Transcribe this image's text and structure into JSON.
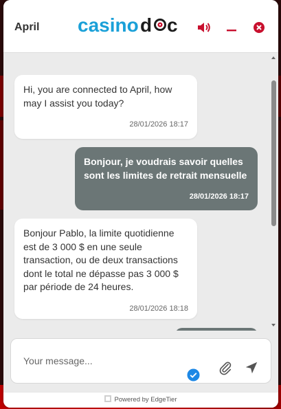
{
  "header": {
    "agent_name": "April",
    "logo_text_a": "casino",
    "logo_text_b": "d",
    "logo_text_c": "c",
    "icons": [
      "sound-icon",
      "minimize-icon",
      "close-icon"
    ]
  },
  "messages": [
    {
      "sender": "agent",
      "text": "Hi, you are connected to April, how\nmay I assist you today?",
      "time": "28/01/2026 18:17"
    },
    {
      "sender": "user",
      "text": "Bonjour, je voudrais savoir quelles\nsont les limites de retrait mensuelle",
      "time": "28/01/2026 18:17"
    },
    {
      "sender": "agent",
      "text": "Bonjour Pablo, la limite quotidienne\nest de 3 000 $ en une seule\ntransaction, ou de deux transactions\ndont le total ne dépasse pas 3 000 $\npar période de 24 heures.",
      "time": "28/01/2026 18:18"
    }
  ],
  "composer": {
    "placeholder": "Your message...",
    "value": ""
  },
  "footer": {
    "powered_by": "Powered by EdgeTier"
  },
  "colors": {
    "brand_blue": "#1aa0d8",
    "brand_dark": "#1c1c1c",
    "accent_red": "#c8102e",
    "user_bubble": "#6b7676",
    "check_blue": "#1e88e5"
  }
}
